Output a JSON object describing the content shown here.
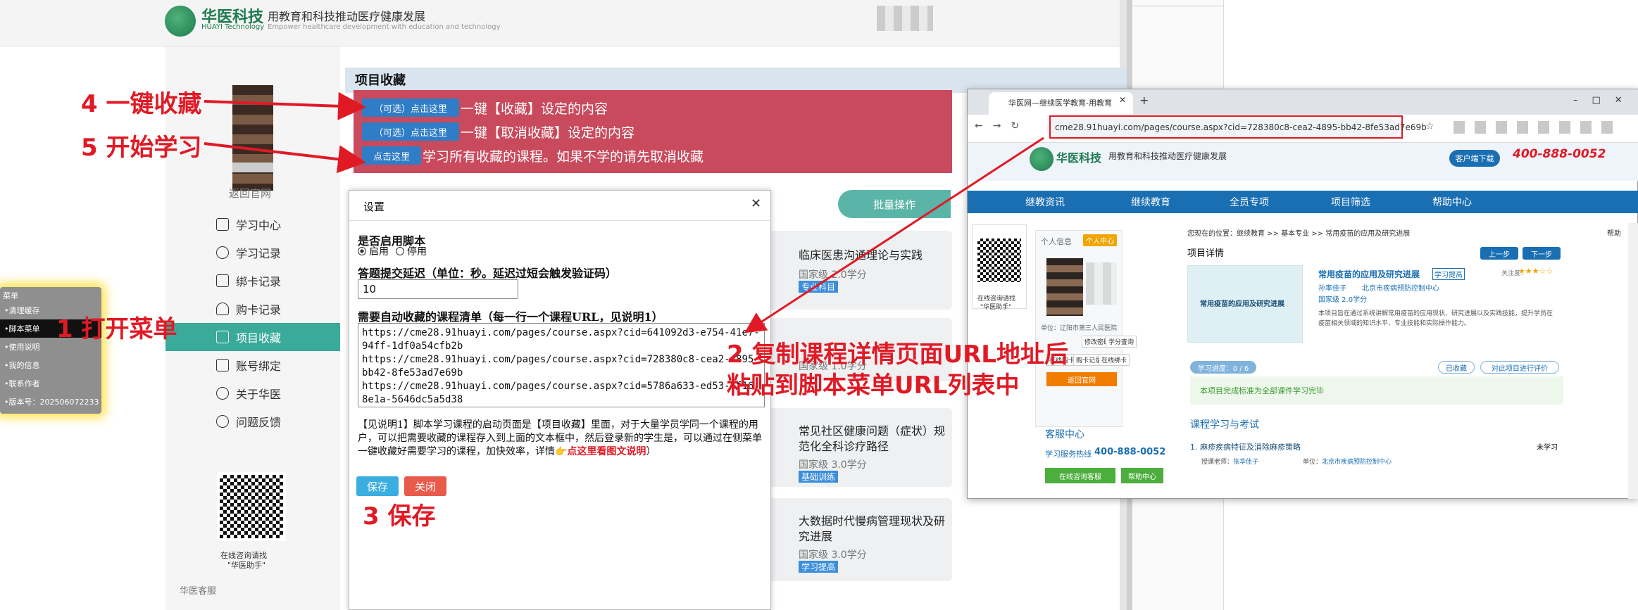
{
  "header": {
    "logo_cn": "华医科技",
    "logo_en": "HUAYI Technology",
    "slogan": "用教育和科技推动医疗健康发展",
    "slogan_en": "Empower healthcare development with education and technology"
  },
  "sidebar": {
    "back_link": "返回官网",
    "items": [
      {
        "label": "学习中心"
      },
      {
        "label": "学习记录"
      },
      {
        "label": "绑卡记录"
      },
      {
        "label": "购卡记录"
      },
      {
        "label": "项目收藏"
      },
      {
        "label": "账号绑定"
      },
      {
        "label": "关于华医"
      },
      {
        "label": "问题反馈"
      }
    ],
    "qr_caption_1": "在线咨询请找",
    "qr_caption_2": "\"华医助手\"",
    "service_label": "华医客服"
  },
  "main": {
    "title": "项目收藏",
    "rows": [
      {
        "button": "（可选）点击这里",
        "text": "一键【收藏】设定的内容"
      },
      {
        "button": "（可选）点击这里",
        "text": "一键【取消收藏】设定的内容"
      },
      {
        "button": "点击这里",
        "text": "学习所有收藏的课程。如果不学的请先取消收藏"
      }
    ],
    "batch_button": "批量操作",
    "courses": [
      {
        "title": "临床医患沟通理论与实践",
        "level": "国家级 2.0学分",
        "tag": "专业科目"
      },
      {
        "title": "",
        "level": "国家级 1.0学分",
        "tag": ""
      },
      {
        "title": "常见社区健康问题（症状）规范化全科诊疗路径",
        "level": "国家级 3.0学分",
        "tag": "基础训练"
      },
      {
        "title": "大数据时代慢病管理现状及研究进展",
        "level": "国家级 3.0学分",
        "tag": "学习提高"
      }
    ]
  },
  "dialog": {
    "title": "设置",
    "enable_label": "是否启用脚本",
    "enable_options": [
      "启用",
      "停用"
    ],
    "delay_label": "答题提交延迟（单位：秒。延迟过短会触发验证码）",
    "delay_value": "10",
    "list_label": "需要自动收藏的课程清单（每一行一个课程URL，见说明1）",
    "list_value": "https://cme28.91huayi.com/pages/course.aspx?cid=641092d3-e754-41e7-94ff-1df0a54cfb2b\nhttps://cme28.91huayi.com/pages/course.aspx?cid=728380c8-cea2-4895-bb42-8fe53ad7e69b\nhttps://cme28.91huayi.com/pages/course.aspx?cid=5786a633-ed53-4f16-8e1a-5646dc5a5d38",
    "note": "【见说明1】脚本学习课程的启动页面是【项目收藏】里面，对于大量学员学同一个课程的用户，可以把需要收藏的课程存入到上面的文本框中，然后登录新的学生是，可以通过在侧菜单一键收藏好需要学习的课程，加快效率，详情",
    "note_link": "👉点这里看图文说明",
    "note_end": "）",
    "save": "保存",
    "close": "关闭"
  },
  "float_menu": {
    "title": "菜单",
    "items": [
      "清理缓存",
      "脚本菜单",
      "使用说明",
      "我的信息",
      "联系作者",
      "版本号：202506072233"
    ]
  },
  "annotations": {
    "a1": "1 打开菜单",
    "a2_line1": "2 复制课程详情页面URL地址后",
    "a2_line2": "粘贴到脚本菜单URL列表中",
    "a3": "3 保存",
    "a4": "4 一键收藏",
    "a5": "5 开始学习"
  },
  "browser": {
    "tab_title": "华医网—继续医学教育-用教育...",
    "url": "cme28.91huayi.com/pages/course.aspx?cid=728380c8-cea2-4895-bb42-8fe53ad7e69b",
    "site_btn": "客户端下载",
    "phone": "400-888-0052",
    "nav": [
      "继教资讯",
      "继续教育",
      "全员专项",
      "项目筛选",
      "帮助中心"
    ],
    "breadcrumb_prefix": "您现在的位置：",
    "breadcrumb": "继续教育 >> 基本专业 >> 常用疫苗的应用及研究进展",
    "help": "帮助",
    "personal_info": "个人信息",
    "personal_center": "个人中心",
    "unit": "单位：辽阳市第三人民医院",
    "account_btns": [
      "修改密码",
      "学分查询",
      "在线购卡",
      "购卡记录",
      "在线绑卡"
    ],
    "back_home": "返回官网",
    "service_title": "客服中心",
    "hotline_label": "学习服务热线",
    "hotline": "400-888-0052",
    "online_consult": "在线咨询客服",
    "help_center": "帮助中心",
    "qr_cap1": "在线咨询请找",
    "qr_cap2": "\"华医助手\"",
    "project_detail": "项目详情",
    "prev": "上一步",
    "next": "下一步",
    "course_name": "常用疫苗的应用及研究进展",
    "study_tag": "学习提高",
    "teacher": "孙率佳子",
    "org": "北京市疾病预防控制中心",
    "credit": "国家级 2.0学分",
    "desc": "本项目旨在通过系统讲解常用疫苗的应用现状、研究进展以及实践技能，提升学员在疫苗相关领域的知识水平、专业技能和实际操作能力。",
    "thumb_text": "常用疫苗的应用及研究进展",
    "progress": "学习进度：0 / 6",
    "collected": "已收藏",
    "evaluate": "对此项目进行评价",
    "notice": "本项目完成标准为全部课件学习完毕",
    "section": "课程学习与考试",
    "lesson": "1. 麻疹疾病特征及消除麻疹策略",
    "lesson_status": "未学习",
    "lesson_teacher_label": "授课老师：",
    "lesson_teacher": "张华佳子",
    "lesson_unit_label": "单位：",
    "lesson_unit": "北京市疾病预防控制中心",
    "attention": "关注度："
  },
  "colors": {
    "accent_teal": "#3aaa9b",
    "red_box": "#c84a5c",
    "blue_button": "#2f7dc6",
    "annotation_red": "#e01a25",
    "site_blue": "#1a6fb3"
  }
}
